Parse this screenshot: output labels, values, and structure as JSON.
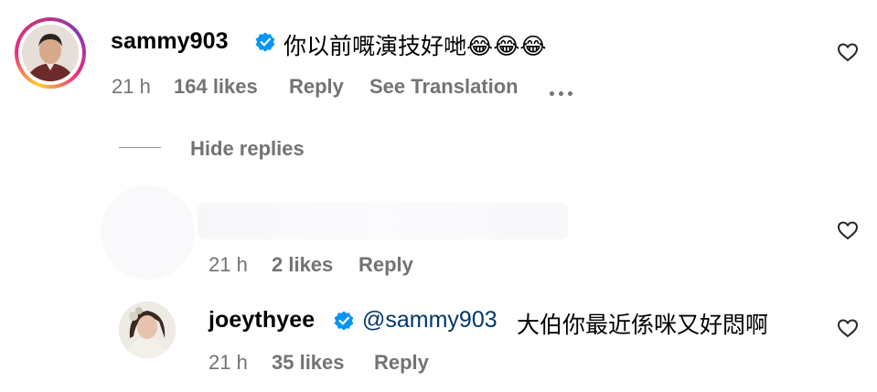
{
  "comments": [
    {
      "username": "sammy903",
      "text": "你以前嘅演技好哋😂😂😂",
      "time": "21 h",
      "likes": "164 likes",
      "reply_label": "Reply",
      "translation_label": "See Translation"
    }
  ],
  "replies_toggle": "Hide replies",
  "replies": [
    {
      "username": "",
      "text": "",
      "time": "21 h",
      "likes": "2 likes",
      "reply_label": "Reply"
    },
    {
      "username": "joeythyee",
      "mention": "@sammy903",
      "text": "大伯你最近係咪又好悶啊",
      "time": "21 h",
      "likes": "35 likes",
      "reply_label": "Reply"
    }
  ],
  "colors": {
    "verified_badge": "#0095f6",
    "meta_text": "#737373",
    "mention": "#00376b"
  },
  "icons": [
    "verified-badge-icon",
    "heart-icon",
    "more-options-icon"
  ]
}
